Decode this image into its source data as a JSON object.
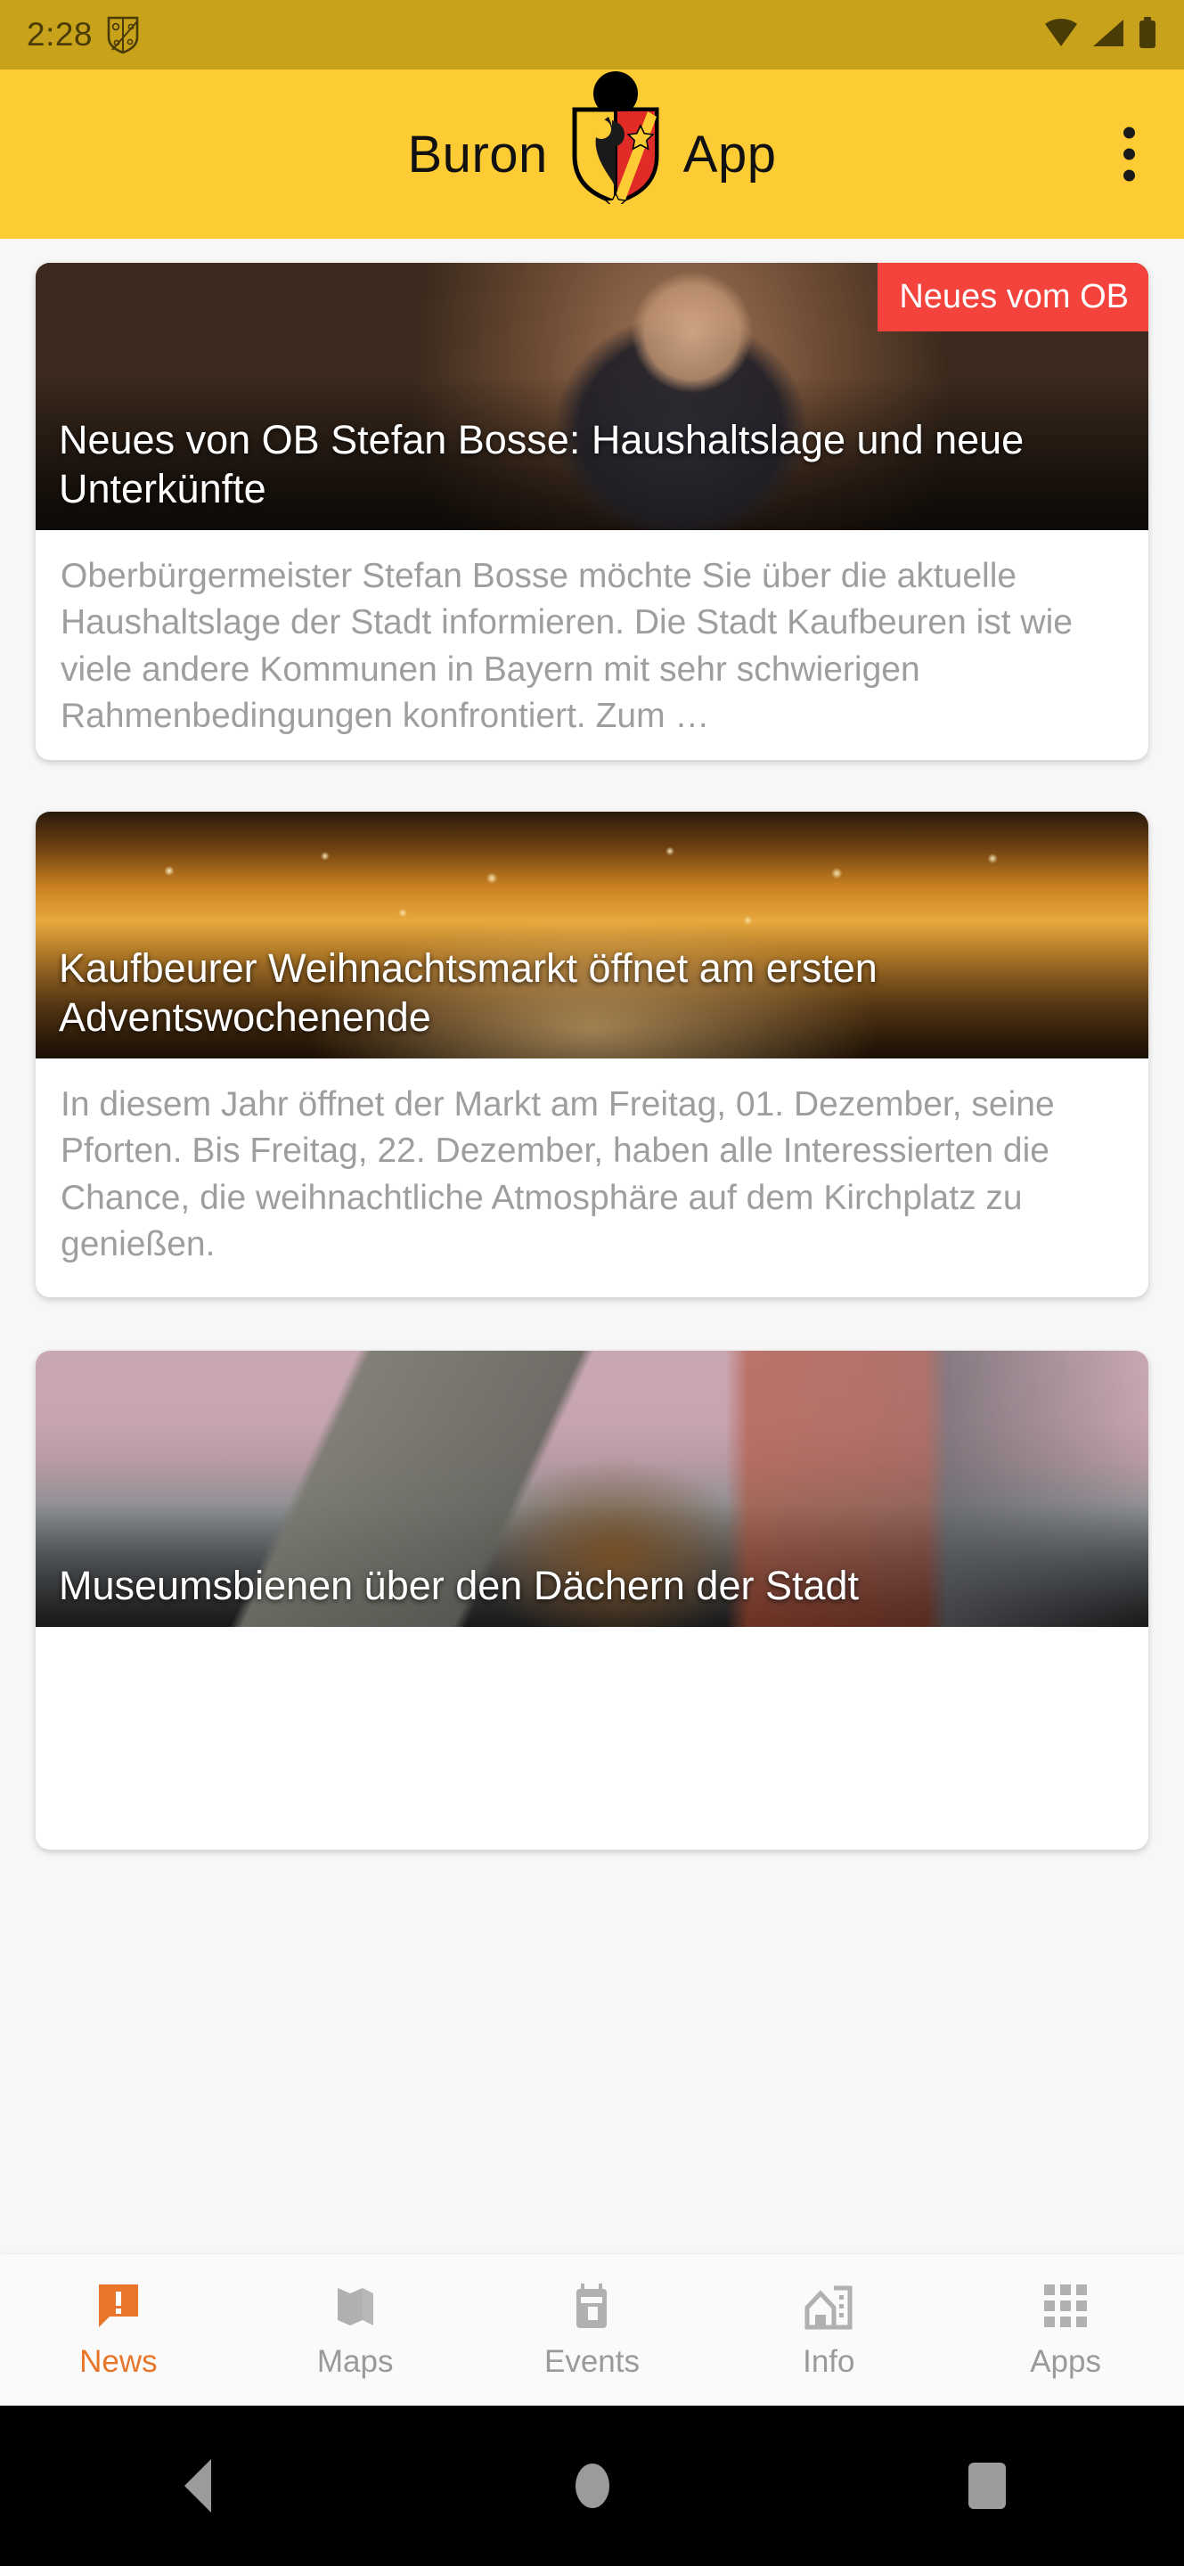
{
  "status_bar": {
    "time": "2:28",
    "icons": [
      "city-crest-icon",
      "wifi-icon",
      "signal-icon",
      "battery-icon"
    ],
    "background": "#c9a21c"
  },
  "app_bar": {
    "title_left": "Buron",
    "title_right": "App",
    "logo": "kaufbeuren-coat-of-arms-icon",
    "overflow": "more-options-icon",
    "background": "#fdcb33"
  },
  "news": {
    "cards": [
      {
        "badge": "Neues vom OB",
        "badge_color": "#F4433C",
        "title": "Neues von OB Stefan Bosse: Haushaltslage und neue Unterkünfte",
        "body": "Oberbürgermeister Stefan Bosse möchte Sie über die aktuelle Haushaltslage der Stadt informieren. Die Stadt Kaufbeuren ist wie viele andere Kommunen in Bayern mit sehr schwierigen Rahmenbedingungen konfrontiert. Zum …",
        "image": "portrait-of-mayor-photo"
      },
      {
        "badge": "",
        "badge_color": "",
        "title": "Kaufbeurer Weihnachtsmarkt öffnet am ersten Adventswochenende",
        "body": "In diesem Jahr öffnet der Markt am Freitag, 01. Dezember, seine Pforten. Bis Freitag, 22. Dezember, haben alle Interessierten die Chance, die weihnachtliche Atmosphäre auf dem Kirchplatz zu genießen.",
        "image": "christmas-market-photo"
      },
      {
        "badge": "",
        "badge_color": "",
        "title": "Museumsbienen über den Dächern der Stadt",
        "body": "",
        "image": "beekeeper-on-rooftop-photo"
      }
    ]
  },
  "bottom_nav": {
    "active_color": "#E8762A",
    "inactive_color": "#9a9a9a",
    "items": [
      {
        "label": "News",
        "icon": "news-alert-icon",
        "active": true
      },
      {
        "label": "Maps",
        "icon": "map-icon",
        "active": false
      },
      {
        "label": "Events",
        "icon": "calendar-icon",
        "active": false
      },
      {
        "label": "Info",
        "icon": "city-info-icon",
        "active": false
      },
      {
        "label": "Apps",
        "icon": "grid-apps-icon",
        "active": false
      }
    ]
  },
  "android_nav": {
    "back": "back-button",
    "home": "home-button",
    "recents": "recents-button"
  }
}
